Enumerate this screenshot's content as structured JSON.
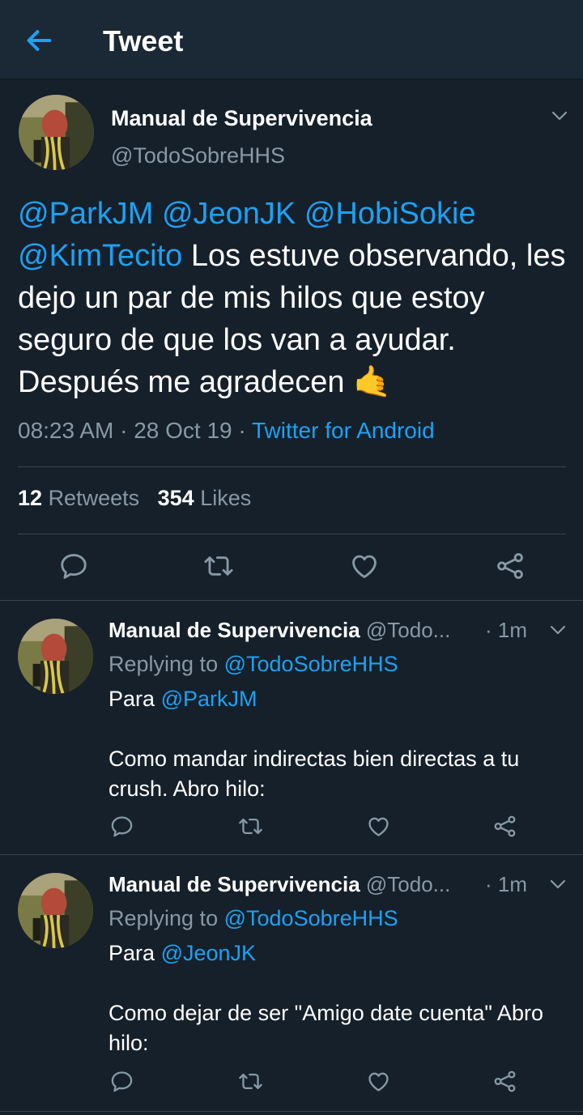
{
  "header": {
    "title": "Tweet"
  },
  "tweet": {
    "author_name": "Manual de Supervivencia",
    "author_handle": "@TodoSobreHHS",
    "mentions": [
      "@ParkJM",
      "@JeonJK",
      "@HobiSokie",
      "@KimTecito"
    ],
    "text": "Los estuve observando, les dejo un par de mis hilos que estoy seguro de que los van a ayudar. Después me agradecen",
    "emoji": "🤙",
    "time": "08:23 AM",
    "date": "28 Oct 19",
    "source": "Twitter for Android",
    "retweets_count": "12",
    "retweets_label": "Retweets",
    "likes_count": "354",
    "likes_label": "Likes"
  },
  "replies": [
    {
      "name": "Manual de Supervivencia",
      "handle": "@Todo...",
      "time": "· 1m",
      "replying_label": "Replying to",
      "replying_to": "@TodoSobreHHS",
      "prefix": "Para",
      "mention": "@ParkJM",
      "body": "Como mandar indirectas bien directas a tu crush. Abro hilo:"
    },
    {
      "name": "Manual de Supervivencia",
      "handle": "@Todo...",
      "time": "· 1m",
      "replying_label": "Replying to",
      "replying_to": "@TodoSobreHHS",
      "prefix": "Para",
      "mention": "@JeonJK",
      "body": "Como dejar de ser \"Amigo date cuenta\" Abro hilo:"
    }
  ],
  "colors": {
    "background": "#15202b",
    "header": "#1b2836",
    "accent": "#1da1f2",
    "muted": "#8899a6",
    "divider": "#38444d"
  },
  "icons": [
    "back-arrow-icon",
    "chevron-down-icon",
    "reply-icon",
    "retweet-icon",
    "like-icon",
    "share-icon"
  ]
}
